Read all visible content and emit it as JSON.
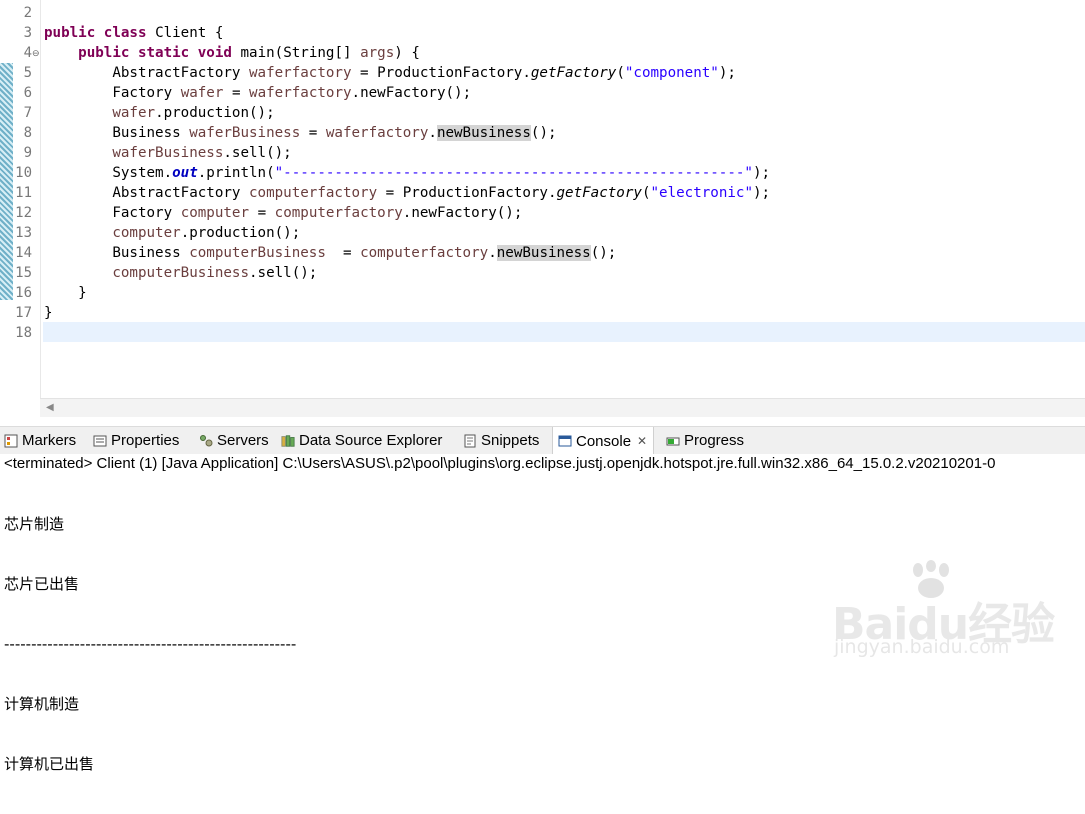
{
  "editor": {
    "line_numbers": [
      "2",
      "3",
      "4",
      "5",
      "6",
      "7",
      "8",
      "9",
      "10",
      "11",
      "12",
      "13",
      "14",
      "15",
      "16",
      "17",
      "18"
    ],
    "line3": {
      "kw1": "public",
      "kw2": "class",
      "name": "Client {"
    },
    "line4": {
      "kw1": "public",
      "kw2": "static",
      "kw3": "void",
      "rest_a": "main(String[] ",
      "param": "args",
      "rest_b": ") {"
    },
    "line5": {
      "type": "AbstractFactory ",
      "var": "waferfactory",
      "mid": " = ProductionFactory.",
      "method": "getFactory",
      "open": "(",
      "arg": "\"component\"",
      "close": ");"
    },
    "line6": {
      "type": "Factory ",
      "var": "wafer",
      "mid": " = ",
      "var2": "waferfactory",
      "rest": ".newFactory();"
    },
    "line7": {
      "var": "wafer",
      "rest": ".production();"
    },
    "line8": {
      "type": "Business ",
      "var": "waferBusiness",
      "mid": " = ",
      "var2": "waferfactory",
      "dot": ".",
      "method": "newBusiness",
      "rest": "();"
    },
    "line9": {
      "var": "waferBusiness",
      "rest": ".sell();"
    },
    "line10": {
      "a": "System.",
      "field": "out",
      "b": ".println(",
      "arg": "\"------------------------------------------------------\"",
      "c": ");"
    },
    "line11": {
      "type": "AbstractFactory ",
      "var": "computerfactory",
      "mid": " = ProductionFactory.",
      "method": "getFactory",
      "open": "(",
      "arg": "\"electronic\"",
      "close": ");"
    },
    "line12": {
      "type": "Factory ",
      "var": "computer",
      "mid": " = ",
      "var2": "computerfactory",
      "rest": ".newFactory();"
    },
    "line13": {
      "var": "computer",
      "rest": ".production();"
    },
    "line14": {
      "type": "Business ",
      "var": "computerBusiness",
      "mid": "  = ",
      "var2": "computerfactory",
      "dot": ".",
      "method": "newBusiness",
      "rest": "();"
    },
    "line15": {
      "var": "computerBusiness",
      "rest": ".sell();"
    },
    "line16": "}",
    "line17": "}"
  },
  "views": {
    "tabs": [
      {
        "label": "Markers",
        "icon": "markers-icon"
      },
      {
        "label": "Properties",
        "icon": "properties-icon"
      },
      {
        "label": "Servers",
        "icon": "servers-icon"
      },
      {
        "label": "Data Source Explorer",
        "icon": "data-source-icon"
      },
      {
        "label": "Snippets",
        "icon": "snippets-icon"
      },
      {
        "label": "Console",
        "icon": "console-icon",
        "active": true
      },
      {
        "label": "Progress",
        "icon": "progress-icon"
      }
    ]
  },
  "console": {
    "header": "<terminated> Client (1) [Java Application] C:\\Users\\ASUS\\.p2\\pool\\plugins\\org.eclipse.justj.openjdk.hotspot.jre.full.win32.x86_64_15.0.2.v20210201-0",
    "lines": [
      "芯片制造",
      "芯片已出售",
      "------------------------------------------------------",
      "计算机制造",
      "计算机已出售"
    ]
  },
  "watermark": {
    "brand": "Baidu经验",
    "url": "jingyan.baidu.com"
  },
  "colors": {
    "keyword": "#7f0055",
    "string": "#2a00ff",
    "variable": "#6a3e3e",
    "current_line": "#e8f2fe"
  }
}
